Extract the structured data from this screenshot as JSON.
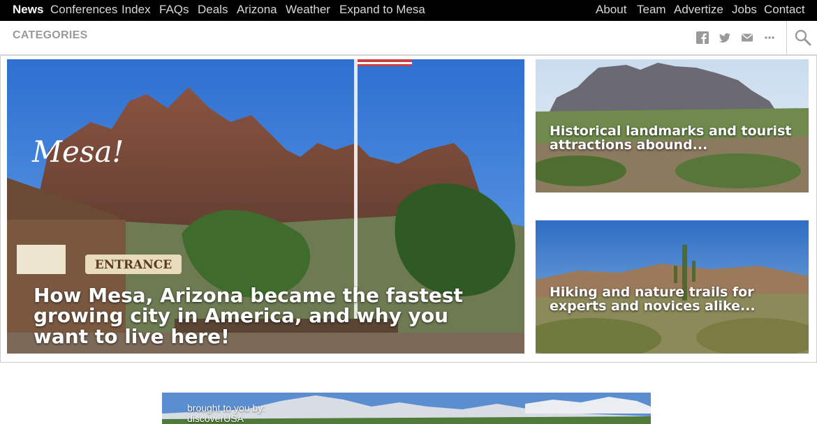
{
  "topnav": {
    "left": [
      "News",
      "Conferences",
      "Index",
      "FAQs",
      "Deals",
      "Arizona",
      "Weather",
      "Expand to Mesa"
    ],
    "right": [
      "About",
      "Team",
      "Advertize",
      "Jobs",
      "Contact"
    ]
  },
  "categories": {
    "label": "CATEGORIES",
    "share_icons": [
      "facebook-icon",
      "twitter-icon",
      "email-icon",
      "more-icon"
    ],
    "search_icon": "search-icon"
  },
  "featured": {
    "overlay_script": "Mesa!",
    "headline": "How Mesa, Arizona became the fastest growing city in America, and why you want to live here!",
    "sign": "ENTRANCE"
  },
  "side_stories": [
    {
      "headline": "Historical landmarks and tourist attractions abound..."
    },
    {
      "headline": "Hiking and nature trails for experts and novices alike..."
    }
  ],
  "banner": {
    "byline_line1": "brought to you by:",
    "byline_line2": "discoverUSA"
  },
  "colors": {
    "nav_bg": "#000000",
    "nav_active": "#ffffff",
    "nav_text": "#d8d8d8",
    "category_text": "#9a9a9a",
    "sky": "#3b7fd4"
  }
}
